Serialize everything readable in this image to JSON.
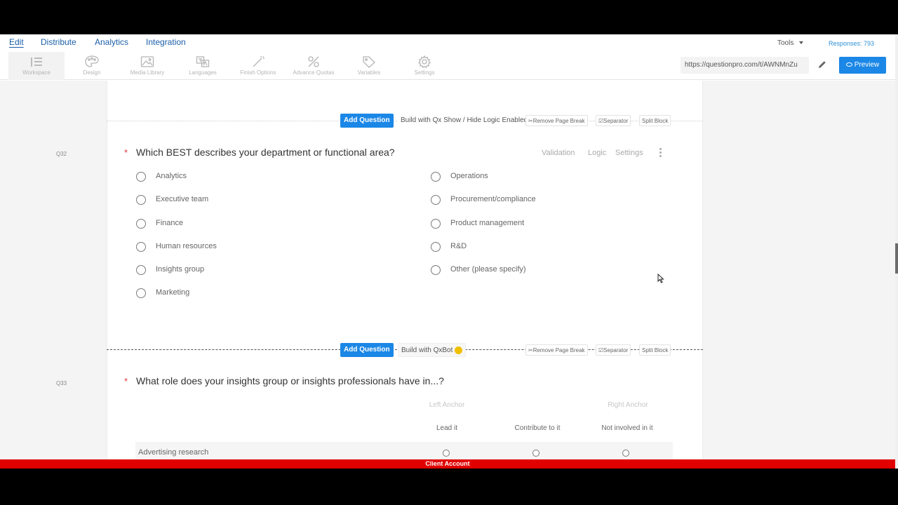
{
  "nav": {
    "edit": "Edit",
    "distribute": "Distribute",
    "analytics": "Analytics",
    "integration": "Integration",
    "tools": "Tools",
    "responses": "Responses: 793"
  },
  "toolbar": {
    "items": [
      {
        "label": "Workspace",
        "icon": "workspace-icon"
      },
      {
        "label": "Design",
        "icon": "palette-icon"
      },
      {
        "label": "Media Library",
        "icon": "image-icon"
      },
      {
        "label": "Languages",
        "icon": "languages-icon"
      },
      {
        "label": "Finish Options",
        "icon": "wand-icon"
      },
      {
        "label": "Advance Quotas",
        "icon": "quotas-icon"
      },
      {
        "label": "Variables",
        "icon": "tag-icon"
      },
      {
        "label": "Settings",
        "icon": "gear-icon"
      }
    ],
    "url": "https://questionpro.com/t/AWNMnZu",
    "preview": "Preview"
  },
  "block1": {
    "add_question": "Add Question",
    "build": "Build with Qx Show / Hide Logic Enabled",
    "remove_page_break": "Remove Page Break",
    "separator": "Separator",
    "split_block": "Split Block"
  },
  "q32": {
    "number": "Q32",
    "required": "*",
    "title": "Which BEST describes your department or functional area?",
    "validation": "Validation",
    "logic": "Logic",
    "settings": "Settings",
    "left_options": [
      "Analytics",
      "Executive team",
      "Finance",
      "Human resources",
      "Insights group",
      "Marketing"
    ],
    "right_options": [
      "Operations",
      "Procurement/compliance",
      "Product management",
      "R&D",
      "Other (please specify)"
    ]
  },
  "block2": {
    "add_question": "Add Question",
    "build": "Build with QxBot",
    "remove_page_break": "Remove Page Break",
    "separator": "Separator",
    "split_block": "Split Block"
  },
  "q33": {
    "number": "Q33",
    "required": "*",
    "title": "What role does your insights group or insights professionals have in...?",
    "left_anchor": "Left Anchor",
    "right_anchor": "Right Anchor",
    "columns": [
      "Lead it",
      "Contribute to it",
      "Not involved in it"
    ],
    "rows": [
      "Advertising research"
    ]
  },
  "footer": {
    "client_account": "Client Account"
  },
  "colors": {
    "accent": "#1b87e6",
    "client_bar": "#e00000",
    "required": "#e03b3b"
  }
}
